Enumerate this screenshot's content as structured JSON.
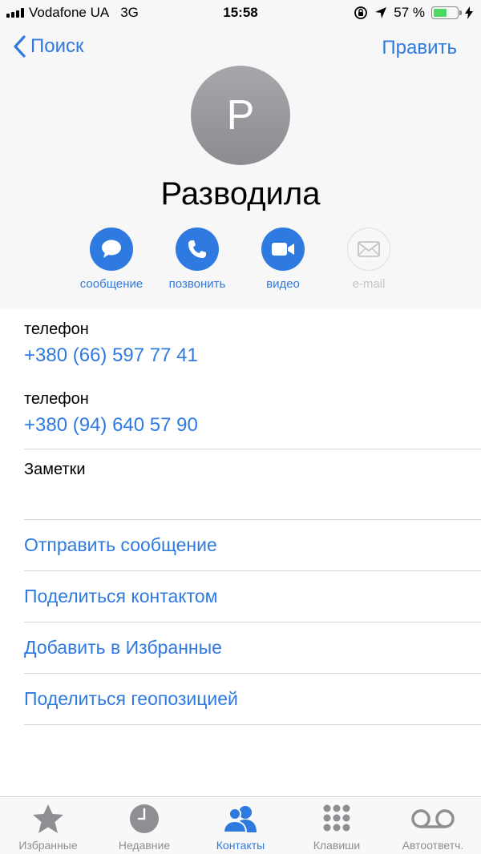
{
  "status_bar": {
    "carrier": "Vodafone UA",
    "network": "3G",
    "time": "15:58",
    "battery": "57 %",
    "battery_level": 0.57
  },
  "nav": {
    "back_label": "Поиск",
    "edit_label": "Править"
  },
  "contact": {
    "initial": "P",
    "name": "Разводила"
  },
  "actions": [
    {
      "label": "сообщение",
      "icon": "message-bubble-icon",
      "enabled": true
    },
    {
      "label": "позвонить",
      "icon": "phone-icon",
      "enabled": true
    },
    {
      "label": "видео",
      "icon": "video-camera-icon",
      "enabled": true
    },
    {
      "label": "e-mail",
      "icon": "envelope-icon",
      "enabled": false
    }
  ],
  "phones": [
    {
      "label": "телефон",
      "value": "+380 (66) 597 77 41"
    },
    {
      "label": "телефон",
      "value": "+380 (94) 640 57 90"
    }
  ],
  "notes": {
    "label": "Заметки"
  },
  "links": [
    "Отправить сообщение",
    "Поделиться контактом",
    "Добавить в Избранные",
    "Поделиться геопозицией"
  ],
  "tabbar": [
    {
      "label": "Избранные",
      "icon": "star-icon",
      "active": false
    },
    {
      "label": "Недавние",
      "icon": "clock-icon",
      "active": false
    },
    {
      "label": "Контакты",
      "icon": "contacts-icon",
      "active": true
    },
    {
      "label": "Клавиши",
      "icon": "keypad-icon",
      "active": false
    },
    {
      "label": "Автоответч.",
      "icon": "voicemail-icon",
      "active": false
    }
  ],
  "colors": {
    "accent": "#2f7ae0",
    "header_bg": "#f7f7f8",
    "battery_green": "#4cd964",
    "inactive_tab": "#8e8e93"
  }
}
